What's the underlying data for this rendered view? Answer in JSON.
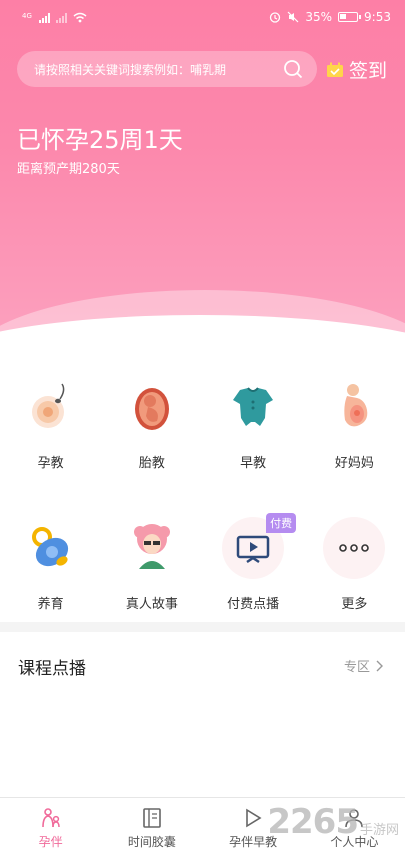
{
  "status_bar": {
    "battery": "35%",
    "time": "9:53",
    "signal_tag": "4G"
  },
  "search": {
    "placeholder": "请按照相关关键词搜索例如：哺乳期"
  },
  "signin": {
    "label": "签到"
  },
  "pregnancy": {
    "title": "已怀孕25周1天",
    "subtitle": "距离预产期280天"
  },
  "grid": {
    "items": [
      {
        "label": "孕教",
        "icon": "sperm-egg-icon"
      },
      {
        "label": "胎教",
        "icon": "fetus-icon"
      },
      {
        "label": "早教",
        "icon": "baby-onesie-icon"
      },
      {
        "label": "好妈妈",
        "icon": "pregnant-mom-icon"
      },
      {
        "label": "养育",
        "icon": "pacifier-icon"
      },
      {
        "label": "真人故事",
        "icon": "woman-avatar-icon"
      },
      {
        "label": "付费点播",
        "icon": "video-play-icon",
        "badge": "付费"
      },
      {
        "label": "更多",
        "icon": "more-dots-icon"
      }
    ]
  },
  "section": {
    "title": "课程点播",
    "link": "专区"
  },
  "bottom_nav": {
    "items": [
      {
        "label": "孕伴",
        "active": true
      },
      {
        "label": "时间胶囊",
        "active": false
      },
      {
        "label": "孕伴早教",
        "active": false
      },
      {
        "label": "个人中心",
        "active": false
      }
    ]
  },
  "watermark": {
    "number": "2265",
    "text": "手游网"
  },
  "colors": {
    "accent": "#fd7fa6",
    "nav_active": "#f06a9a",
    "badge": "#b58cf0"
  }
}
